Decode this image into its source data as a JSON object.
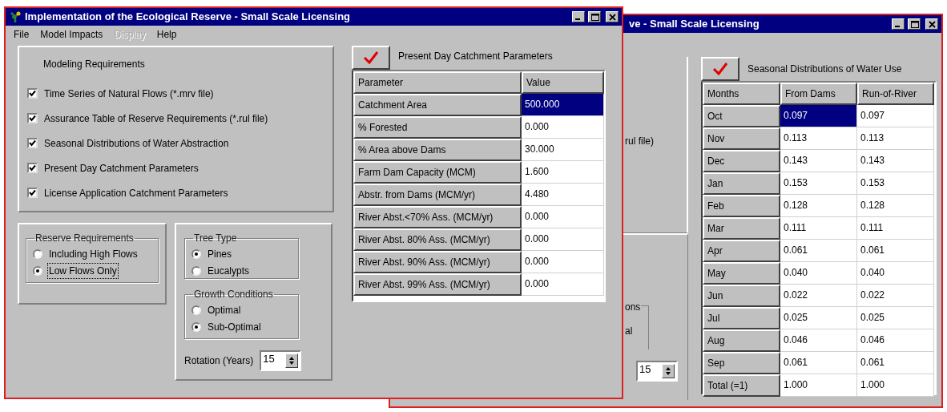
{
  "back_window": {
    "title": "ve - Small Scale Licensing",
    "fragments": [
      {
        "kind": "text",
        "text": "rul file)"
      },
      {
        "kind": "legend",
        "text": "ons"
      },
      {
        "kind": "text",
        "text": "al"
      }
    ],
    "rotation_value": "15",
    "seasonal": {
      "title": "Seasonal Distributions of Water Use",
      "columns": [
        "Months",
        "From Dams",
        "Run-of-River"
      ],
      "rows": [
        {
          "month": "Oct",
          "from_dams": "0.097",
          "run_of_river": "0.097",
          "selected": true
        },
        {
          "month": "Nov",
          "from_dams": "0.113",
          "run_of_river": "0.113",
          "selected": false
        },
        {
          "month": "Dec",
          "from_dams": "0.143",
          "run_of_river": "0.143",
          "selected": false
        },
        {
          "month": "Jan",
          "from_dams": "0.153",
          "run_of_river": "0.153",
          "selected": false
        },
        {
          "month": "Feb",
          "from_dams": "0.128",
          "run_of_river": "0.128",
          "selected": false
        },
        {
          "month": "Mar",
          "from_dams": "0.111",
          "run_of_river": "0.111",
          "selected": false
        },
        {
          "month": "Apr",
          "from_dams": "0.061",
          "run_of_river": "0.061",
          "selected": false
        },
        {
          "month": "May",
          "from_dams": "0.040",
          "run_of_river": "0.040",
          "selected": false
        },
        {
          "month": "Jun",
          "from_dams": "0.022",
          "run_of_river": "0.022",
          "selected": false
        },
        {
          "month": "Jul",
          "from_dams": "0.025",
          "run_of_river": "0.025",
          "selected": false
        },
        {
          "month": "Aug",
          "from_dams": "0.046",
          "run_of_river": "0.046",
          "selected": false
        },
        {
          "month": "Sep",
          "from_dams": "0.061",
          "run_of_river": "0.061",
          "selected": false
        },
        {
          "month": "Total (=1)",
          "from_dams": "1.000",
          "run_of_river": "1.000",
          "selected": false
        }
      ]
    }
  },
  "window": {
    "title": "Implementation of the Ecological Reserve - Small Scale Licensing",
    "menu": [
      {
        "label": "File",
        "disabled": false
      },
      {
        "label": "Model Impacts",
        "disabled": false
      },
      {
        "label": "Display",
        "disabled": true
      },
      {
        "label": "Help",
        "disabled": false
      }
    ],
    "modeling": {
      "title": "Modeling Requirements",
      "items": [
        {
          "label": "Time Series of Natural Flows (*.mrv file)",
          "checked": true
        },
        {
          "label": "Assurance Table of Reserve Requirements (*.rul file)",
          "checked": true
        },
        {
          "label": "Seasonal Distributions of Water Abstraction",
          "checked": true
        },
        {
          "label": "Present Day Catchment Parameters",
          "checked": true
        },
        {
          "label": "License Application Catchment Parameters",
          "checked": true
        }
      ]
    },
    "reserve": {
      "title": "Reserve Requirements",
      "options": [
        {
          "label": "Including High Flows",
          "selected": false,
          "focused": false
        },
        {
          "label": "Low Flows Only",
          "selected": true,
          "focused": true
        }
      ]
    },
    "tree_type": {
      "title": "Tree Type",
      "options": [
        {
          "label": "Pines",
          "selected": true
        },
        {
          "label": "Eucalypts",
          "selected": false
        }
      ]
    },
    "growth": {
      "title": "Growth Conditions",
      "options": [
        {
          "label": "Optimal",
          "selected": false
        },
        {
          "label": "Sub-Optimal",
          "selected": true
        }
      ]
    },
    "rotation": {
      "label": "Rotation (Years)",
      "value": "15"
    },
    "parameters": {
      "title": "Present Day Catchment Parameters",
      "columns": [
        "Parameter",
        "Value"
      ],
      "rows": [
        {
          "parameter": "Catchment Area",
          "value": "500.000",
          "selected": true
        },
        {
          "parameter": "% Forested",
          "value": "0.000",
          "selected": false
        },
        {
          "parameter": "% Area above Dams",
          "value": "30.000",
          "selected": false
        },
        {
          "parameter": "Farm Dam Capacity (MCM)",
          "value": "1.600",
          "selected": false
        },
        {
          "parameter": "Abstr. from Dams (MCM/yr)",
          "value": "4.480",
          "selected": false
        },
        {
          "parameter": "River Abst.<70% Ass. (MCM/yr)",
          "value": "0.000",
          "selected": false
        },
        {
          "parameter": "River Abst. 80% Ass. (MCM/yr)",
          "value": "0.000",
          "selected": false
        },
        {
          "parameter": "River Abst. 90% Ass. (MCM/yr)",
          "value": "0.000",
          "selected": false
        },
        {
          "parameter": "River Abst. 99% Ass. (MCM/yr)",
          "value": "0.000",
          "selected": false
        }
      ]
    }
  }
}
